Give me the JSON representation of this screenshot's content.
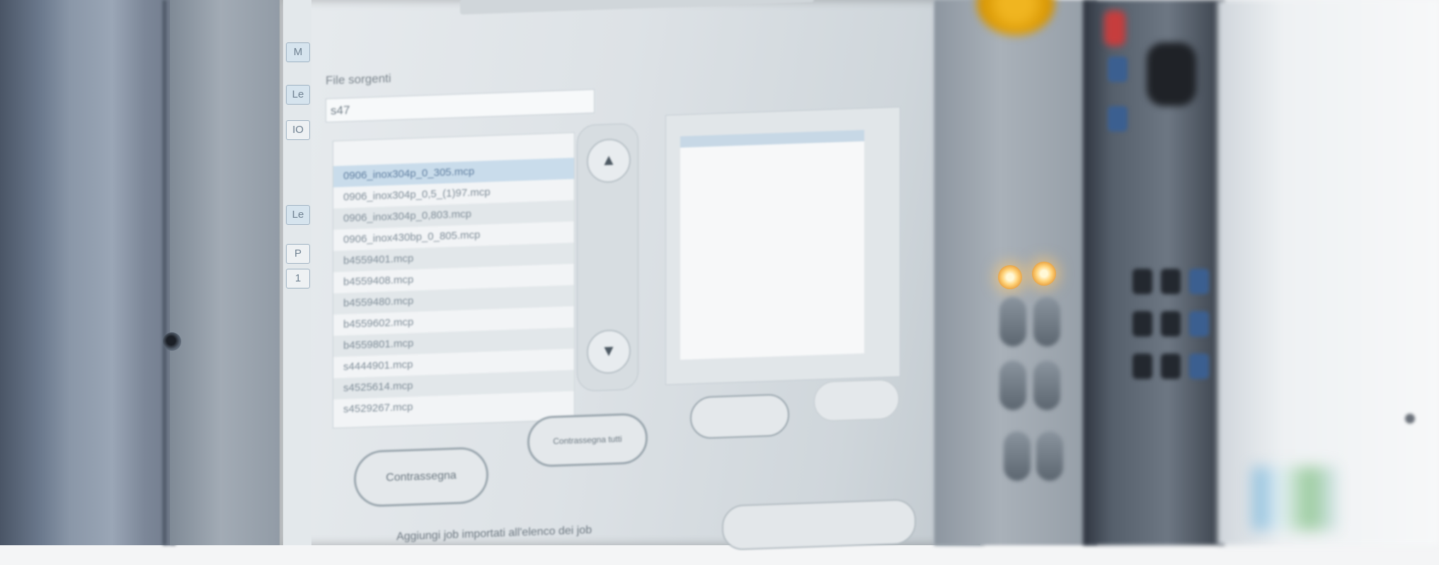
{
  "screen": {
    "side_tabs": [
      "M",
      "Le",
      "IO",
      "Le",
      "P",
      "1"
    ],
    "section_label": "File sorgenti",
    "search_value": "s47",
    "files": [
      "0906_inox304p_0_305.mcp",
      "0906_inox304p_0,5_(1)97.mcp",
      "0906_inox304p_0,803.mcp",
      "0906_inox430bp_0_805.mcp",
      "b4559401.mcp",
      "b4559408.mcp",
      "b4559480.mcp",
      "b4559602.mcp",
      "b4559801.mcp",
      "s4444901.mcp",
      "s4525614.mcp",
      "s4529267.mcp"
    ],
    "selected_index": 0,
    "buttons": {
      "mark": "Contrassegna",
      "mark_all": "Contrassegna tutti"
    },
    "footer_text": "Aggiungi job importati all'elenco dei job"
  }
}
